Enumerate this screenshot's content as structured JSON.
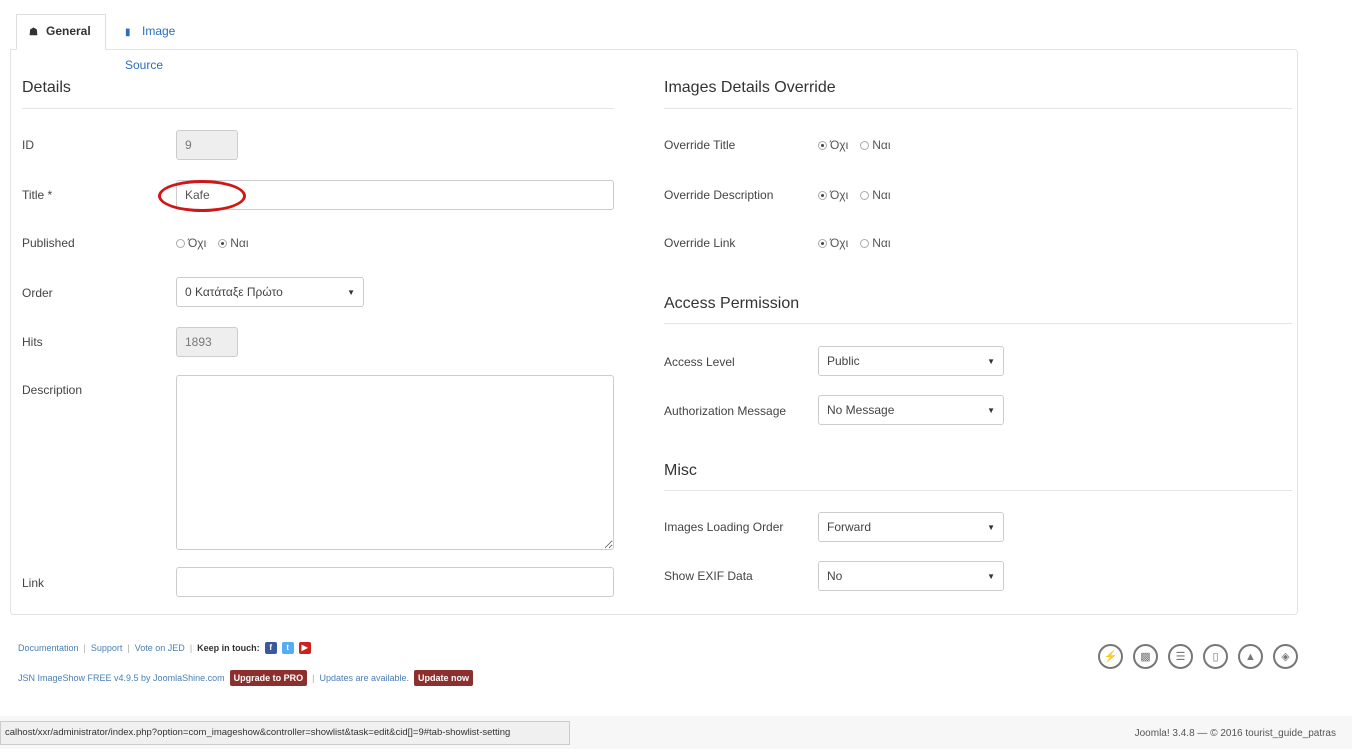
{
  "tabs": [
    {
      "label": "General",
      "icon": "home-icon"
    },
    {
      "label": "Image Source",
      "icon": "folder-icon"
    }
  ],
  "details": {
    "title": "Details",
    "id_label": "ID",
    "id_value": "9",
    "title_label": "Title *",
    "title_value": "Kafe",
    "published_label": "Published",
    "published_options": [
      "Όχι",
      "Ναι"
    ],
    "published_selected": "Ναι",
    "order_label": "Order",
    "order_value": "0 Κατάταξε Πρώτο",
    "hits_label": "Hits",
    "hits_value": "1893",
    "description_label": "Description",
    "description_value": "",
    "link_label": "Link",
    "link_value": ""
  },
  "override": {
    "title": "Images Details Override",
    "rows": [
      {
        "label": "Override Title",
        "options": [
          "Όχι",
          "Ναι"
        ],
        "selected": "Όχι"
      },
      {
        "label": "Override Description",
        "options": [
          "Όχι",
          "Ναι"
        ],
        "selected": "Όχι"
      },
      {
        "label": "Override Link",
        "options": [
          "Όχι",
          "Ναι"
        ],
        "selected": "Όχι"
      }
    ]
  },
  "access": {
    "title": "Access Permission",
    "level_label": "Access Level",
    "level_value": "Public",
    "auth_label": "Authorization Message",
    "auth_value": "No Message"
  },
  "misc": {
    "title": "Misc",
    "loading_label": "Images Loading Order",
    "loading_value": "Forward",
    "exif_label": "Show EXIF Data",
    "exif_value": "No"
  },
  "footer": {
    "documentation": "Documentation",
    "support": "Support",
    "vote": "Vote on JED",
    "keep_in_touch": "Keep in touch:",
    "version_text": "JSN ImageShow FREE v4.9.5 by JoomlaShine.com",
    "upgrade_label": "Upgrade to PRO",
    "updates_text": "Updates are available.",
    "update_now_label": "Update now",
    "social": [
      {
        "icon": "facebook-icon",
        "glyph": "f",
        "color": "#3b5998"
      },
      {
        "icon": "twitter-icon",
        "glyph": "t",
        "color": "#55acee"
      },
      {
        "icon": "youtube-icon",
        "glyph": "▶",
        "color": "#cd201f"
      }
    ],
    "product_icons": [
      "poweradmin-icon",
      "imageshow-icon",
      "uniform-icon",
      "mobilize-icon",
      "pagebuilder-icon",
      "easyslider-icon"
    ]
  },
  "status_bar": {
    "url": "calhost/xxr/administrator/index.php?option=com_imageshow&controller=showlist&task=edit&cid[]=9#tab-showlist-setting"
  },
  "copyright": "Joomla! 3.4.8 — © 2016 tourist_guide_patras"
}
